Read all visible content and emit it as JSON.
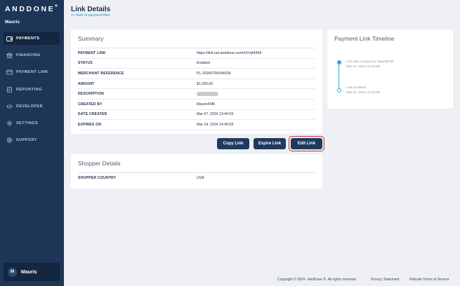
{
  "brand": {
    "logo_text": "ANDDONE",
    "logo_mark": "®"
  },
  "sidebar": {
    "user_name": "Mauris",
    "items": [
      {
        "label": "PAYMENTS",
        "icon": "wallet-icon",
        "active": true
      },
      {
        "label": "FINANCING",
        "icon": "bank-icon",
        "active": false
      },
      {
        "label": "PAYMENT LINK",
        "icon": "link-card-icon",
        "active": false
      },
      {
        "label": "REPORTING",
        "icon": "report-icon",
        "active": false
      },
      {
        "label": "DEVELOPER",
        "icon": "code-icon",
        "active": false
      },
      {
        "label": "SETTINGS",
        "icon": "gear-icon",
        "active": false
      },
      {
        "label": "SUPPORT",
        "icon": "support-icon",
        "active": false
      }
    ],
    "account": {
      "initial": "M",
      "name": "Mauris"
    }
  },
  "header": {
    "title": "Link Details",
    "back_link": "<< back to payment links"
  },
  "summary": {
    "title": "Summary",
    "rows": [
      {
        "key": "PAYMENT LINK",
        "value": "https://link.uat.anddone.com/#/Vvj4449d"
      },
      {
        "key": "STATUS",
        "value": "Enabled"
      },
      {
        "key": "MERCHANT REFERENCE",
        "value": "PL-20240705044039"
      },
      {
        "key": "AMOUNT",
        "value": "$1,000.00"
      },
      {
        "key": "DESCRIPTION",
        "value": ""
      },
      {
        "key": "CREATED BY",
        "value": "MaurisFMK"
      },
      {
        "key": "DATE CREATED",
        "value": "Mar 07, 2024 13:40:59"
      },
      {
        "key": "EXPIRES ON",
        "value": "Mar 14, 2024 14:40:59"
      }
    ]
  },
  "actions": {
    "copy_link": "Copy Link",
    "expire_link": "Expire Link",
    "edit_link": "Edit Link"
  },
  "shopper": {
    "title": "Shopper Details",
    "rows": [
      {
        "key": "SHOPPER COUNTRY",
        "value": "USA"
      }
    ]
  },
  "timeline": {
    "title": "Payment Link Timeline",
    "events": [
      {
        "text": "Link was created by MaurisFMK",
        "time": "Mar 07, 2024 13:40:59"
      },
      {
        "text": "Link Enabled",
        "time": "Mar 07, 2024 13:40:59"
      }
    ]
  },
  "footer": {
    "copyright": "Copyright © 2024 - AndDone ®. All rights reserved.",
    "privacy": "Privacy Statement",
    "terms": "Website Terms of Service"
  },
  "colors": {
    "sidebar_bg": "#1d3557",
    "accent": "#2fa4dd",
    "button": "#1e3a5f",
    "highlight": "#c8313b"
  }
}
